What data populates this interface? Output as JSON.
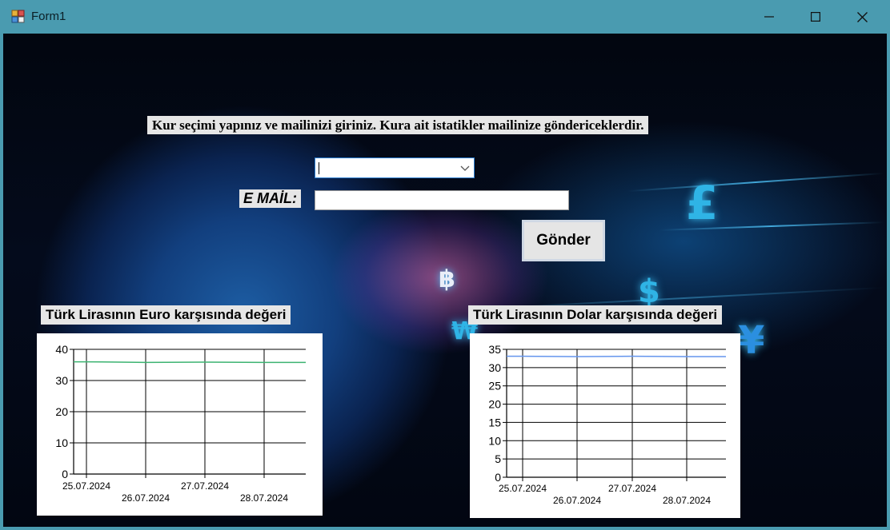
{
  "window": {
    "title": "Form1",
    "minimize_symbol": "—",
    "maximize_symbol": "☐",
    "close_symbol": "✕"
  },
  "form": {
    "instruction": "Kur seçimi yapınız ve mailinizi giriniz. Kura ait istatikler mailinize göndericeklerdir.",
    "currency_select_value": "",
    "email_label": "E MAİL:",
    "email_value": "",
    "send_button": "Gönder"
  },
  "background_symbols": [
    "£",
    "฿",
    "$",
    "₩",
    "¥"
  ],
  "charts": {
    "euro": {
      "label": "Türk Lirasının Euro karşısında değeri"
    },
    "dollar": {
      "label": "Türk Lirasının Dolar karşısında değeri"
    }
  },
  "chart_data": [
    {
      "type": "line",
      "title": "Türk Lirasının Euro karşısında değeri",
      "x": [
        "25.07.2024",
        "26.07.2024",
        "27.07.2024",
        "28.07.2024"
      ],
      "series": [
        {
          "values": [
            36.0,
            35.8,
            35.9,
            35.8
          ],
          "color": "#3cb371"
        }
      ],
      "ylim": [
        0,
        40
      ],
      "yticks": [
        0,
        10,
        20,
        30,
        40
      ],
      "grid": true,
      "xlabel": "",
      "ylabel": ""
    },
    {
      "type": "line",
      "title": "Türk Lirasının Dolar karşısında değeri",
      "x": [
        "25.07.2024",
        "26.07.2024",
        "27.07.2024",
        "28.07.2024"
      ],
      "series": [
        {
          "values": [
            33.1,
            33.0,
            33.1,
            33.0
          ],
          "color": "#6495ed"
        }
      ],
      "ylim": [
        0,
        35
      ],
      "yticks": [
        0,
        5,
        10,
        15,
        20,
        25,
        30,
        35
      ],
      "grid": true,
      "xlabel": "",
      "ylabel": ""
    }
  ]
}
